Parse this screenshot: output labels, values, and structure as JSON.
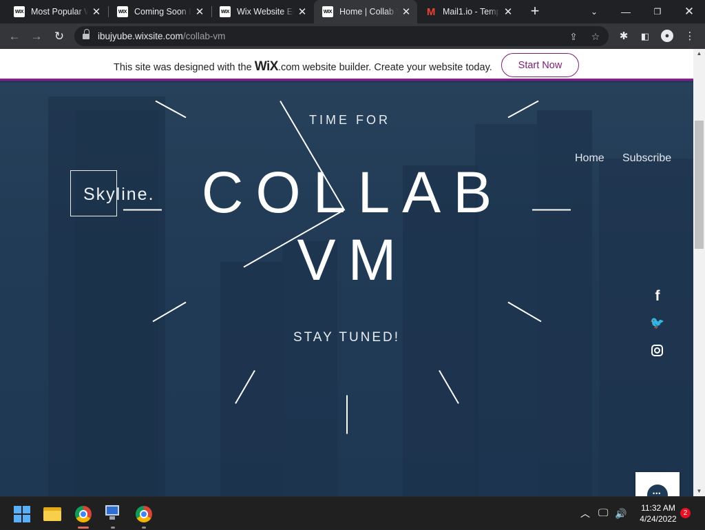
{
  "browser": {
    "tabs": [
      {
        "title": "Most Popular W",
        "favicon": "WIX",
        "active": false
      },
      {
        "title": "Coming Soon La",
        "favicon": "WIX",
        "active": false
      },
      {
        "title": "Wix Website Edi",
        "favicon": "WIX",
        "active": false
      },
      {
        "title": "Home | Collab V",
        "favicon": "WIX",
        "active": true
      },
      {
        "title": "Mail1.io - Temp",
        "favicon": "M",
        "active": false
      }
    ],
    "new_tab": "+",
    "url_host": "ibujyube.wixsite.com",
    "url_path": "/collab-vm"
  },
  "banner": {
    "text_before": "This site was designed with the ",
    "wix_logo": "WiX",
    "text_after": ".com website builder. Create your website today.",
    "cta": "Start Now",
    "accent_color": "#7d1d77"
  },
  "site": {
    "logo": "Skyline.",
    "nav": [
      "Home",
      "Subscribe"
    ],
    "overtext": "TIME FOR",
    "title_line1": "COLLAB",
    "title_line2": "VM",
    "tagline": "STAY TUNED!",
    "social_icons": [
      "facebook-icon",
      "twitter-icon",
      "instagram-icon"
    ],
    "chat_icon": "chat-bubble-icon",
    "hero_color": "#213a55"
  },
  "taskbar": {
    "apps": [
      "start-icon",
      "file-explorer-icon",
      "chrome-profile-icon",
      "remote-desktop-icon",
      "chrome-icon"
    ],
    "time": "11:32 AM",
    "date": "4/24/2022",
    "notification_count": "2"
  }
}
